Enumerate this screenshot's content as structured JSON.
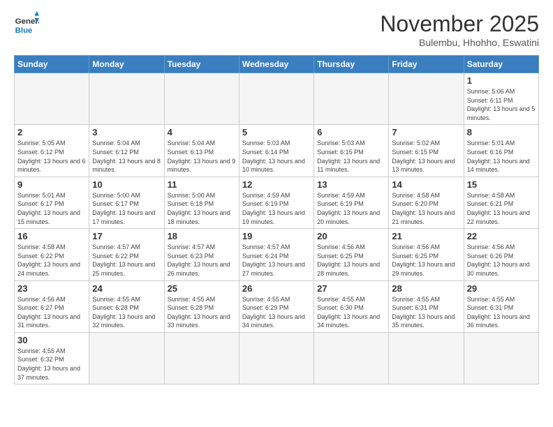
{
  "header": {
    "logo_general": "General",
    "logo_blue": "Blue",
    "title": "November 2025",
    "subtitle": "Bulembu, Hhohho, Eswatini"
  },
  "weekdays": [
    "Sunday",
    "Monday",
    "Tuesday",
    "Wednesday",
    "Thursday",
    "Friday",
    "Saturday"
  ],
  "weeks": [
    [
      {
        "day": "",
        "info": ""
      },
      {
        "day": "",
        "info": ""
      },
      {
        "day": "",
        "info": ""
      },
      {
        "day": "",
        "info": ""
      },
      {
        "day": "",
        "info": ""
      },
      {
        "day": "",
        "info": ""
      },
      {
        "day": "1",
        "info": "Sunrise: 5:06 AM\nSunset: 6:11 PM\nDaylight: 13 hours\nand 5 minutes."
      }
    ],
    [
      {
        "day": "2",
        "info": "Sunrise: 5:05 AM\nSunset: 6:12 PM\nDaylight: 13 hours\nand 6 minutes."
      },
      {
        "day": "3",
        "info": "Sunrise: 5:04 AM\nSunset: 6:12 PM\nDaylight: 13 hours\nand 8 minutes."
      },
      {
        "day": "4",
        "info": "Sunrise: 5:04 AM\nSunset: 6:13 PM\nDaylight: 13 hours\nand 9 minutes."
      },
      {
        "day": "5",
        "info": "Sunrise: 5:03 AM\nSunset: 6:14 PM\nDaylight: 13 hours\nand 10 minutes."
      },
      {
        "day": "6",
        "info": "Sunrise: 5:03 AM\nSunset: 6:15 PM\nDaylight: 13 hours\nand 11 minutes."
      },
      {
        "day": "7",
        "info": "Sunrise: 5:02 AM\nSunset: 6:15 PM\nDaylight: 13 hours\nand 13 minutes."
      },
      {
        "day": "8",
        "info": "Sunrise: 5:01 AM\nSunset: 6:16 PM\nDaylight: 13 hours\nand 14 minutes."
      }
    ],
    [
      {
        "day": "9",
        "info": "Sunrise: 5:01 AM\nSunset: 6:17 PM\nDaylight: 13 hours\nand 15 minutes."
      },
      {
        "day": "10",
        "info": "Sunrise: 5:00 AM\nSunset: 6:17 PM\nDaylight: 13 hours\nand 17 minutes."
      },
      {
        "day": "11",
        "info": "Sunrise: 5:00 AM\nSunset: 6:18 PM\nDaylight: 13 hours\nand 18 minutes."
      },
      {
        "day": "12",
        "info": "Sunrise: 4:59 AM\nSunset: 6:19 PM\nDaylight: 13 hours\nand 19 minutes."
      },
      {
        "day": "13",
        "info": "Sunrise: 4:59 AM\nSunset: 6:19 PM\nDaylight: 13 hours\nand 20 minutes."
      },
      {
        "day": "14",
        "info": "Sunrise: 4:58 AM\nSunset: 6:20 PM\nDaylight: 13 hours\nand 21 minutes."
      },
      {
        "day": "15",
        "info": "Sunrise: 4:58 AM\nSunset: 6:21 PM\nDaylight: 13 hours\nand 22 minutes."
      }
    ],
    [
      {
        "day": "16",
        "info": "Sunrise: 4:58 AM\nSunset: 6:22 PM\nDaylight: 13 hours\nand 24 minutes."
      },
      {
        "day": "17",
        "info": "Sunrise: 4:57 AM\nSunset: 6:22 PM\nDaylight: 13 hours\nand 25 minutes."
      },
      {
        "day": "18",
        "info": "Sunrise: 4:57 AM\nSunset: 6:23 PM\nDaylight: 13 hours\nand 26 minutes."
      },
      {
        "day": "19",
        "info": "Sunrise: 4:57 AM\nSunset: 6:24 PM\nDaylight: 13 hours\nand 27 minutes."
      },
      {
        "day": "20",
        "info": "Sunrise: 4:56 AM\nSunset: 6:25 PM\nDaylight: 13 hours\nand 28 minutes."
      },
      {
        "day": "21",
        "info": "Sunrise: 4:56 AM\nSunset: 6:25 PM\nDaylight: 13 hours\nand 29 minutes."
      },
      {
        "day": "22",
        "info": "Sunrise: 4:56 AM\nSunset: 6:26 PM\nDaylight: 13 hours\nand 30 minutes."
      }
    ],
    [
      {
        "day": "23",
        "info": "Sunrise: 4:56 AM\nSunset: 6:27 PM\nDaylight: 13 hours\nand 31 minutes."
      },
      {
        "day": "24",
        "info": "Sunrise: 4:55 AM\nSunset: 6:28 PM\nDaylight: 13 hours\nand 32 minutes."
      },
      {
        "day": "25",
        "info": "Sunrise: 4:55 AM\nSunset: 6:28 PM\nDaylight: 13 hours\nand 33 minutes."
      },
      {
        "day": "26",
        "info": "Sunrise: 4:55 AM\nSunset: 6:29 PM\nDaylight: 13 hours\nand 34 minutes."
      },
      {
        "day": "27",
        "info": "Sunrise: 4:55 AM\nSunset: 6:30 PM\nDaylight: 13 hours\nand 34 minutes."
      },
      {
        "day": "28",
        "info": "Sunrise: 4:55 AM\nSunset: 6:31 PM\nDaylight: 13 hours\nand 35 minutes."
      },
      {
        "day": "29",
        "info": "Sunrise: 4:55 AM\nSunset: 6:31 PM\nDaylight: 13 hours\nand 36 minutes."
      }
    ],
    [
      {
        "day": "30",
        "info": "Sunrise: 4:55 AM\nSunset: 6:32 PM\nDaylight: 13 hours\nand 37 minutes."
      },
      {
        "day": "",
        "info": ""
      },
      {
        "day": "",
        "info": ""
      },
      {
        "day": "",
        "info": ""
      },
      {
        "day": "",
        "info": ""
      },
      {
        "day": "",
        "info": ""
      },
      {
        "day": "",
        "info": ""
      }
    ]
  ]
}
